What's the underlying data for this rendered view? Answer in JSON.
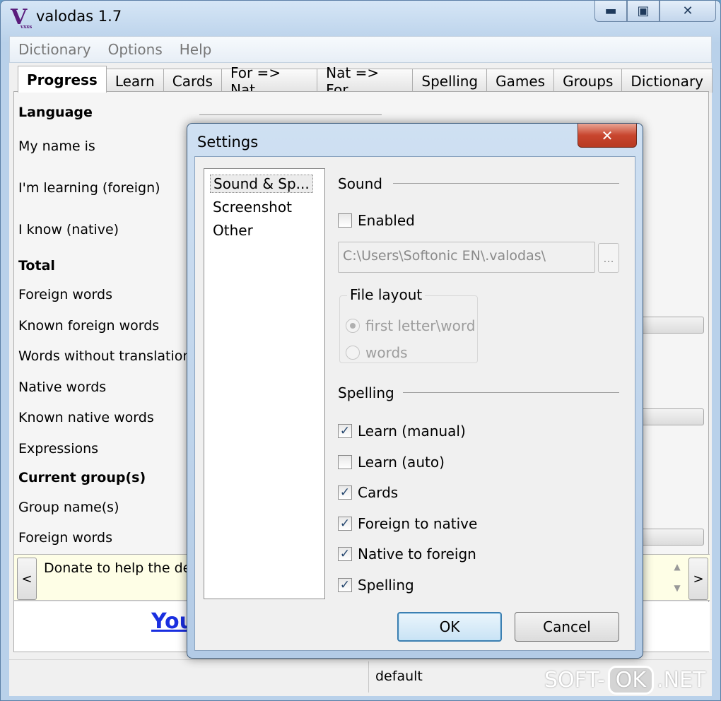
{
  "window": {
    "title": "valodas 1.7",
    "logo_letter": "V",
    "logo_sub": "vxxs",
    "min_glyph": "▬",
    "max_glyph": "▣",
    "close_glyph": "✕"
  },
  "menubar": {
    "items": [
      "Dictionary",
      "Options",
      "Help"
    ]
  },
  "tabs": [
    "Progress",
    "Learn",
    "Cards",
    "For => Nat",
    "Nat => For",
    "Spelling",
    "Games",
    "Groups",
    "Dictionary"
  ],
  "active_tab": "Progress",
  "progress": {
    "language_header": "Language",
    "my_name": "My name is",
    "learning": "I'm learning (foreign)",
    "know": "I know (native)",
    "total_header": "Total",
    "foreign_words": "Foreign words",
    "known_foreign": "Known foreign words",
    "without_translation": "Words without translation",
    "native_words": "Native words",
    "known_native": "Known native words",
    "expressions": "Expressions",
    "current_group_header": "Current group(s)",
    "group_names": "Group name(s)",
    "group_foreign_words": "Foreign words"
  },
  "donate": {
    "text": "Donate to help the dev",
    "prev": "<",
    "next": ">",
    "scroll_up": "▲",
    "scroll_down": "▼"
  },
  "link": {
    "text": "You"
  },
  "statusbar": {
    "group": "default"
  },
  "watermark": {
    "left": "SOFT-",
    "ok": "OK",
    "right": ".NET"
  },
  "settings_dialog": {
    "title": "Settings",
    "close_glyph": "✕",
    "categories": [
      "Sound & Sp...",
      "Screenshot",
      "Other"
    ],
    "selected_category": "Sound & Sp...",
    "sound": {
      "title": "Sound",
      "enabled_label": "Enabled",
      "enabled": false,
      "path_value": "C:\\Users\\Softonic EN\\.valodas\\",
      "browse_label": "...",
      "file_layout_title": "File layout",
      "layout_options": [
        "first letter\\word",
        "words"
      ],
      "layout_selected": "first letter\\word"
    },
    "spelling": {
      "title": "Spelling",
      "options": [
        {
          "label": "Learn (manual)",
          "checked": true
        },
        {
          "label": "Learn (auto)",
          "checked": false
        },
        {
          "label": "Cards",
          "checked": true
        },
        {
          "label": "Foreign to native",
          "checked": true
        },
        {
          "label": "Native to foreign",
          "checked": true
        },
        {
          "label": "Spelling",
          "checked": true
        }
      ]
    },
    "ok_label": "OK",
    "cancel_label": "Cancel",
    "check_glyph": "✓"
  }
}
